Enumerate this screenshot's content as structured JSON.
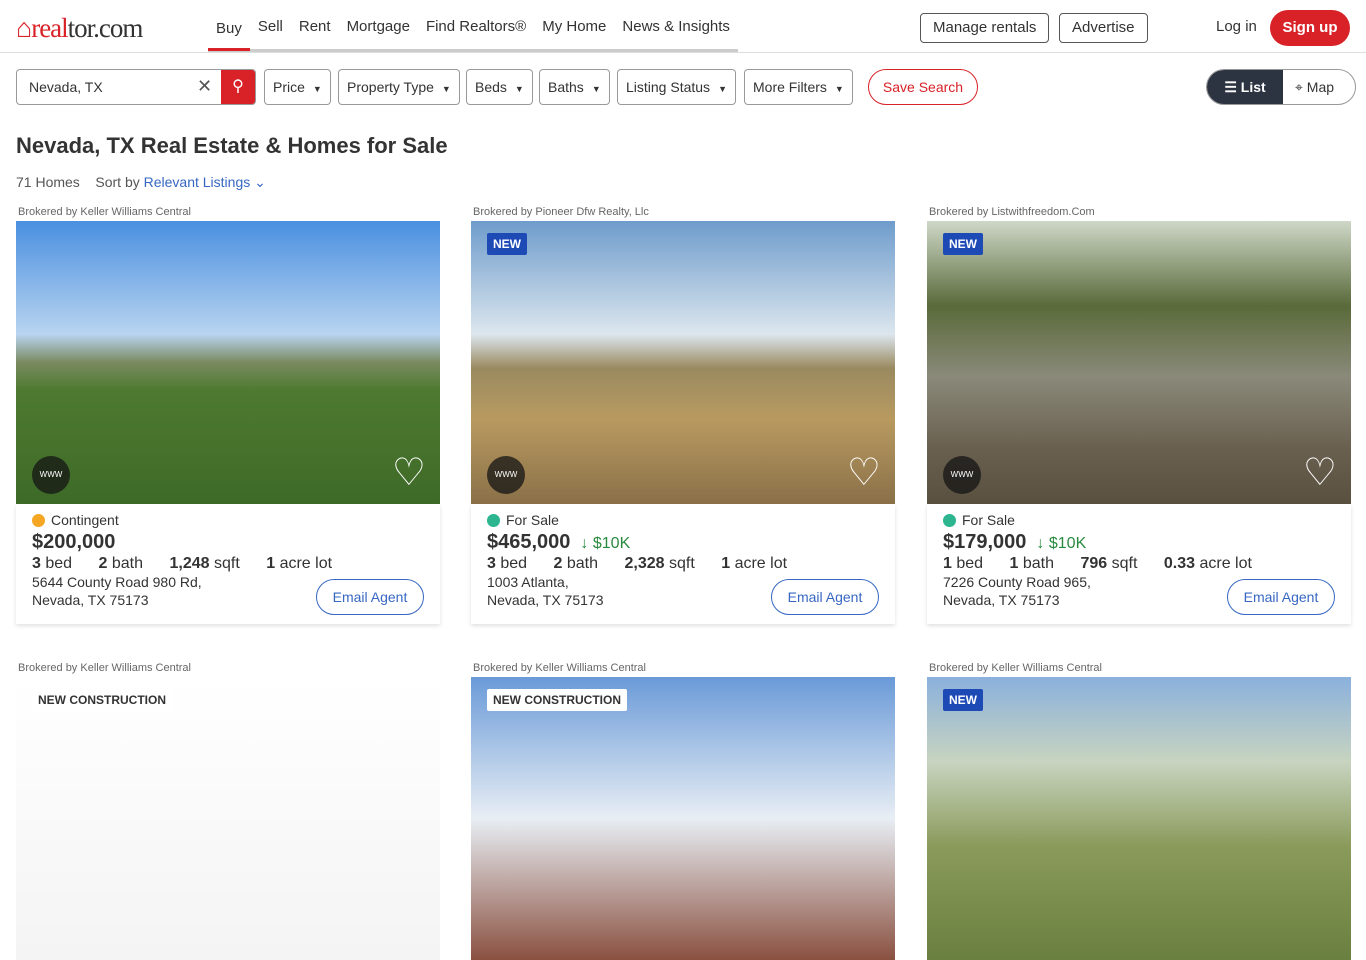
{
  "header": {
    "logo": "realtor.com",
    "nav": [
      "Buy",
      "Sell",
      "Rent",
      "Mortgage",
      "Find Realtors®",
      "My Home",
      "News & Insights"
    ],
    "manage_rentals": "Manage rentals",
    "advertise": "Advertise",
    "login": "Log in",
    "signup": "Sign up"
  },
  "filters": {
    "search_value": "Nevada, TX",
    "price": "Price",
    "property_type": "Property Type",
    "beds": "Beds",
    "baths": "Baths",
    "listing_status": "Listing Status",
    "more_filters": "More Filters",
    "save_search": "Save Search",
    "list": "List",
    "map": "Map"
  },
  "page": {
    "title": "Nevada, TX Real Estate & Homes for Sale",
    "count": "71 Homes",
    "sort_label": "Sort by",
    "sort_value": "Relevant Listings"
  },
  "listings": [
    {
      "broker": "Brokered by Keller Williams Central",
      "badge": "",
      "status": "Contingent",
      "status_color": "#f5a623",
      "price": "$200,000",
      "drop": "",
      "beds": "3",
      "baths": "2",
      "sqft": "1,248",
      "lot": "1",
      "addr1": "5644 County Road 980 Rd,",
      "addr2": "Nevada, TX 75173",
      "email": "Email Agent"
    },
    {
      "broker": "Brokered by Pioneer Dfw Realty, Llc",
      "badge": "NEW",
      "status": "For Sale",
      "status_color": "#2cb58f",
      "price": "$465,000",
      "drop": "$10K",
      "beds": "3",
      "baths": "2",
      "sqft": "2,328",
      "lot": "1",
      "addr1": "1003 Atlanta,",
      "addr2": "Nevada, TX 75173",
      "email": "Email Agent"
    },
    {
      "broker": "Brokered by Listwithfreedom.Com",
      "badge": "NEW",
      "status": "For Sale",
      "status_color": "#2cb58f",
      "price": "$179,000",
      "drop": "$10K",
      "beds": "1",
      "baths": "1",
      "sqft": "796",
      "lot": "0.33",
      "addr1": "7226 County Road 965,",
      "addr2": "Nevada, TX 75173",
      "email": "Email Agent"
    },
    {
      "broker": "Brokered by Keller Williams Central",
      "badge": "NEW CONSTRUCTION"
    },
    {
      "broker": "Brokered by Keller Williams Central",
      "badge": "NEW CONSTRUCTION"
    },
    {
      "broker": "Brokered by Keller Williams Central",
      "badge": "NEW"
    }
  ],
  "labels": {
    "bed": "bed",
    "bath": "bath",
    "sqft": "sqft",
    "lot": "acre lot",
    "www": "WWW"
  }
}
